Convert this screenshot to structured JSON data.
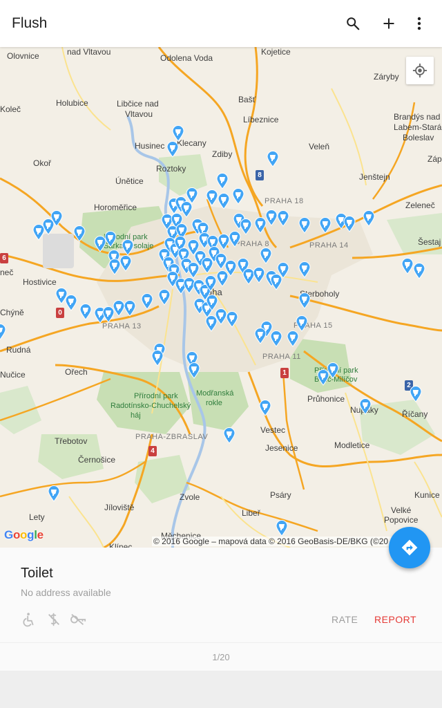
{
  "app": {
    "title": "Flush",
    "actions": [
      {
        "name": "search",
        "icon": "search-icon"
      },
      {
        "name": "add",
        "icon": "plus-icon"
      },
      {
        "name": "more",
        "icon": "more-vert-icon"
      }
    ]
  },
  "map": {
    "attribution": "© 2016 Google – mapová data © 2016 GeoBasis-DE/BKG (©20",
    "attribution_tail": "gle",
    "google_logo": [
      "G",
      "o",
      "o",
      "g",
      "l",
      "e"
    ],
    "google_colors": [
      "#4285f4",
      "#ea4335",
      "#fbbc05",
      "#4285f4",
      "#34a853",
      "#ea4335"
    ],
    "pin_color": "#42a5f5",
    "places": {
      "olovnice": "Olovnice",
      "nad_vltavou": "nad Vltavou",
      "odolena_voda": "Odolena Voda",
      "kojetice": "Kojetice",
      "zaryby": "Záryby",
      "kolec": "Koleč",
      "holubice": "Holubice",
      "libcice": "Libčice nad",
      "vltavou": "Vltavou",
      "bast": "Bašť",
      "libeznice": "Líbeznice",
      "brandys1": "Brandýs nad",
      "brandys2": "Labem-Stará",
      "brandys3": "Boleslav",
      "husinec": "Husinec",
      "klecany": "Klecany",
      "zdiby": "Zdiby",
      "velen": "Veleň",
      "roztoky": "Roztoky",
      "okor": "Okoř",
      "unetice": "Únětice",
      "jenstejn": "Jenštejn",
      "zap": "Záp",
      "horomerice": "Horoměřice",
      "praha18": "PRAHA 18",
      "zelenec": "Zeleneč",
      "park_lysolaje1": "Přírodní park",
      "park_lysolaje2": "Šárka-Lysolaje",
      "praha8": "PRAHA 8",
      "praha14": "PRAHA 14",
      "sestaj": "Šestaj",
      "nec": "neč",
      "hostivice": "Hostivice",
      "chyne": "Chýně",
      "praha": "Praha",
      "sterboholy": "Sterboholy",
      "praha13": "PRAHA 13",
      "praha15": "PRAHA 15",
      "rudna": "Rudná",
      "praha11": "PRAHA 11",
      "nucice": "Nučice",
      "orech": "Ořech",
      "botic1": "Přírodní park",
      "botic2": "Botič-Milíčov",
      "pruhonice": "Průhonice",
      "nupaky": "Nupaky",
      "ricany": "Říčany",
      "radotin1": "Přírodní park",
      "radotin2": "Radotínsko-Chuchelský",
      "radotin3": "háj",
      "modranska1": "Modřanská",
      "modranska2": "rokle",
      "vestec": "Vestec",
      "trebotov": "Třebotov",
      "zbraslav": "PRAHA-ZBRASLAV",
      "jesenice": "Jesenice",
      "modletice": "Modletice",
      "cernosice": "Černošice",
      "kunice": "Kunice",
      "zvole": "Zvole",
      "psary": "Psáry",
      "lety": "Lety",
      "jiloviste": "Jíloviště",
      "libor": "Libeř",
      "velke_popovice1": "Velké",
      "velke_popovice2": "Popovice",
      "mechenice": "Měchenice",
      "klinec": "Klínec"
    },
    "routes": {
      "r8": "8",
      "r6": "6",
      "r0": "0",
      "r1": "1",
      "r4": "4",
      "r2": "2"
    }
  },
  "detail": {
    "name": "Toilet",
    "address": "No address available",
    "features": [
      "wheelchair-icon",
      "no-fee-icon",
      "no-key-icon"
    ],
    "rate_label": "RATE",
    "report_label": "REPORT",
    "pager": "1/20"
  }
}
